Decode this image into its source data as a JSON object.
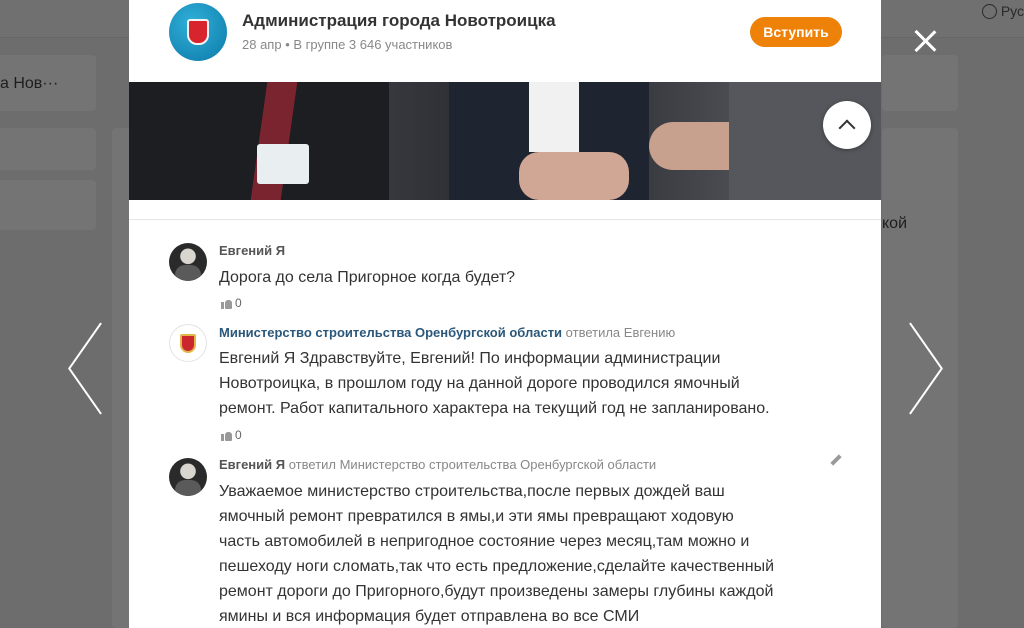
{
  "background": {
    "language": "Рус",
    "left_fragment": "а Нов···",
    "right_fragment": "кой"
  },
  "group": {
    "name": "Администрация города Новотроицка",
    "date": "28 апр",
    "meta": "В группе 3 646 участников",
    "join_label": "Вступить"
  },
  "comments": [
    {
      "author": "Евгений Я",
      "reply_info": "",
      "text": "Дорога до села Пригорное когда будет?",
      "likes": "0"
    },
    {
      "author": "Министерство строительства Оренбургской области",
      "reply_info": "ответила Евгению",
      "text": "Евгений Я Здравствуйте, Евгений! По информации администрации Новотроицка, в прошлом году на данной дороге проводился ямочный ремонт. Работ капитального характера на текущий год не запланировано.",
      "likes": "0"
    },
    {
      "author": "Евгений Я",
      "reply_info": "ответил Министерство строительства Оренбургской области",
      "text": "Уважаемое министерство строительства,после первых дождей ваш ямочный ремонт превратился в ямы,и эти ямы превращают ходовую часть автомобилей в непригодное состояние через месяц,там можно и пешеходу ноги сломать,так что есть предложение,сделайте качественный ремонт дороги до Пригорного,будут произведены замеры глубины каждой ямины и вся информация будет отправлена во все СМИ",
      "likes": ""
    }
  ],
  "icons": {
    "close": "close-icon",
    "prev": "chevron-left-icon",
    "next": "chevron-right-icon",
    "scroll_up": "chevron-up-icon",
    "like": "thumb-up-icon",
    "edit": "pencil-icon",
    "language": "globe-icon"
  },
  "colors": {
    "accent": "#ee8208",
    "link": "#2b587a",
    "overlay": "#6d6d6d"
  }
}
